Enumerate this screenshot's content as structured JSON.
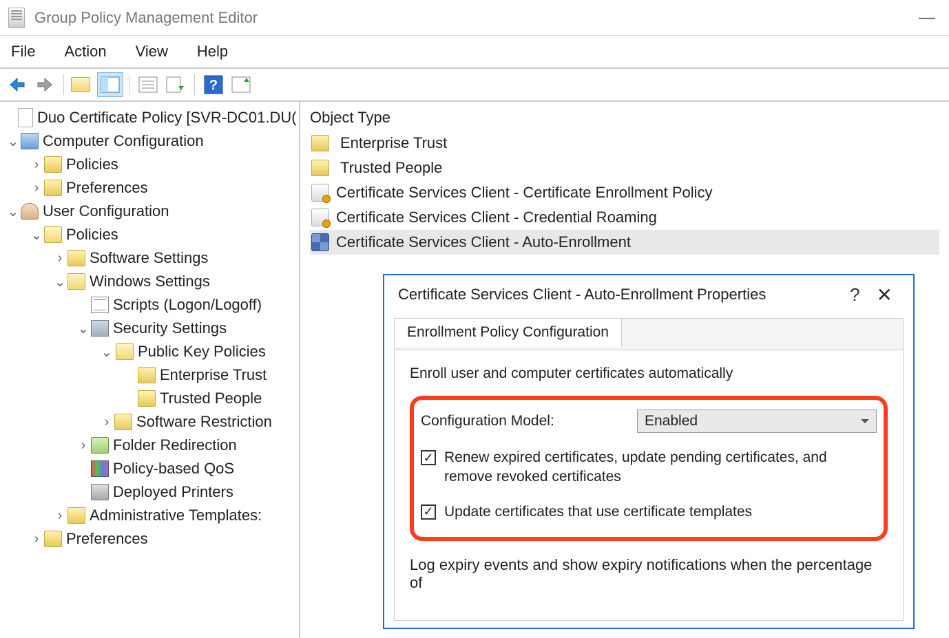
{
  "window": {
    "title": "Group Policy Management Editor"
  },
  "menu": {
    "file": "File",
    "action": "Action",
    "view": "View",
    "help": "Help"
  },
  "tree": {
    "root": "Duo Certificate Policy [SVR-DC01.DU(",
    "computer_config": "Computer Configuration",
    "cc_policies": "Policies",
    "cc_prefs": "Preferences",
    "user_config": "User Configuration",
    "uc_policies": "Policies",
    "software_settings": "Software Settings",
    "windows_settings": "Windows Settings",
    "scripts": "Scripts (Logon/Logoff)",
    "security_settings": "Security Settings",
    "pkp": "Public Key Policies",
    "enterprise_trust": "Enterprise Trust",
    "trusted_people": "Trusted People",
    "software_restriction": "Software Restriction",
    "folder_redirection": "Folder Redirection",
    "policy_qos": "Policy-based QoS",
    "deployed_printers": "Deployed Printers",
    "admin_templates": "Administrative Templates:",
    "uc_prefs": "Preferences"
  },
  "content": {
    "header": "Object Type",
    "items": [
      "Enterprise Trust",
      "Trusted People",
      "Certificate Services Client - Certificate Enrollment Policy",
      "Certificate Services Client - Credential Roaming",
      "Certificate Services Client - Auto-Enrollment"
    ]
  },
  "dialog": {
    "title": "Certificate Services Client - Auto-Enrollment Properties",
    "tab": "Enrollment Policy Configuration",
    "intro": "Enroll user and computer certificates automatically",
    "config_label": "Configuration Model:",
    "config_value": "Enabled",
    "chk1": "Renew expired certificates, update pending certificates, and remove revoked certificates",
    "chk2": "Update certificates that use certificate templates",
    "footer": "Log expiry events and show expiry notifications when the percentage of"
  }
}
